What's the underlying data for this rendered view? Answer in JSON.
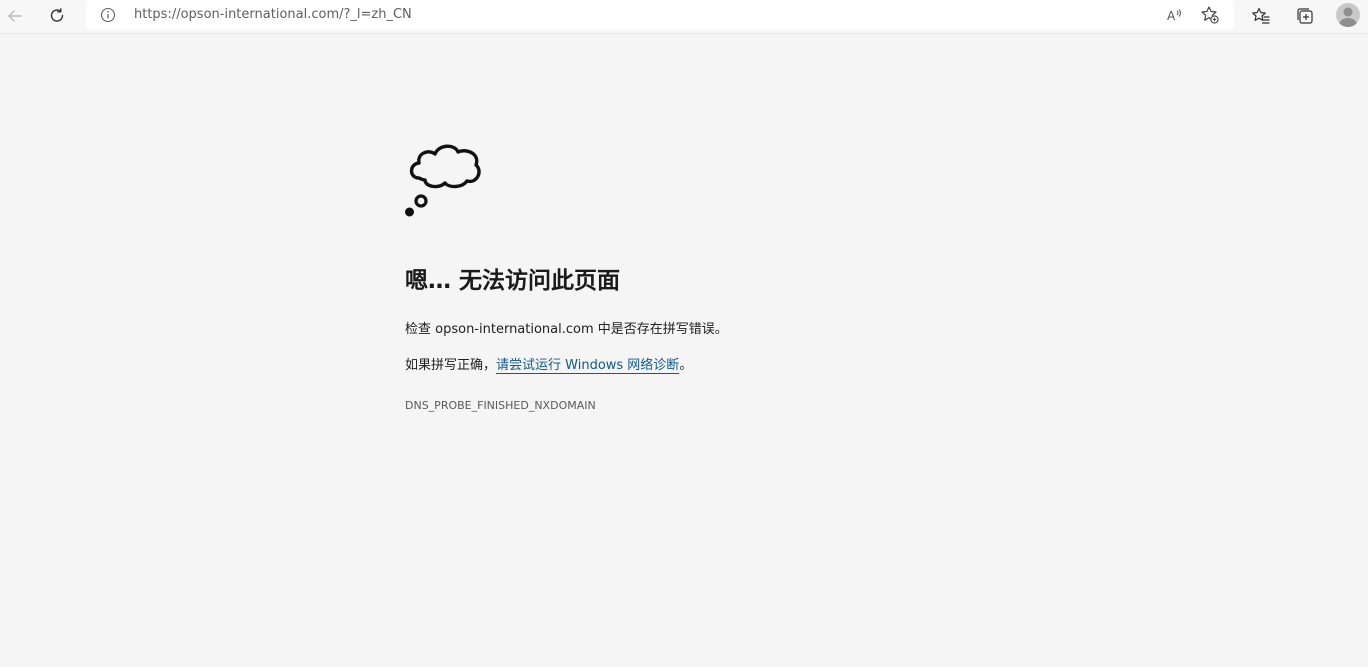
{
  "browser": {
    "url": "https://opson-international.com/?_l=zh_CN",
    "icons": {
      "back": "arrow-left-icon",
      "refresh": "refresh-icon",
      "info": "info-icon",
      "read_aloud": "read-aloud-icon",
      "add_favorite": "add-favorite-icon",
      "favorites": "favorites-icon",
      "collections": "collections-icon",
      "profile": "profile-avatar-icon"
    }
  },
  "error": {
    "icon": "thought-cloud-icon",
    "title": "嗯… 无法访问此页面",
    "check_prefix": "检查 ",
    "domain": "opson-international.com",
    "check_suffix": " 中是否存在拼写错误。",
    "spelling_ok_prefix": "如果拼写正确，",
    "diagnostics_link": "请尝试运行 Windows 网络诊断",
    "spelling_ok_suffix": "。",
    "code": "DNS_PROBE_FINISHED_NXDOMAIN"
  },
  "colors": {
    "page_bg": "#f5f5f5",
    "link": "#0f5a8e",
    "text": "#202020"
  }
}
